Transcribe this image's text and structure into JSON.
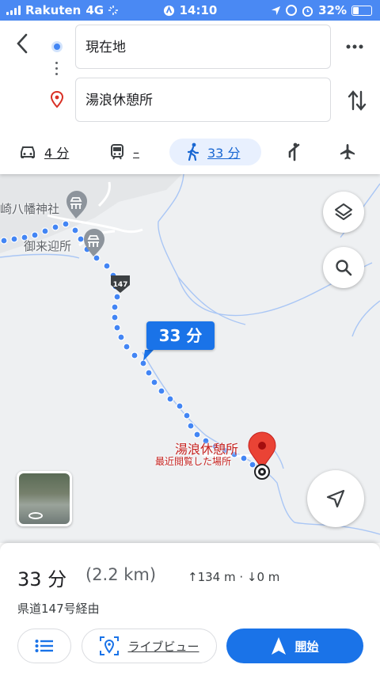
{
  "status_bar": {
    "carrier": "Rakuten",
    "network": "4G",
    "time": "14:10",
    "battery": "32%"
  },
  "directions": {
    "origin": "現在地",
    "destination": "湯浪休憩所",
    "modes": [
      {
        "icon": "car-icon",
        "label": "4 分"
      },
      {
        "icon": "train-icon",
        "label": "–"
      },
      {
        "icon": "walk-icon",
        "label": "33 分",
        "selected": true
      },
      {
        "icon": "ride-hail-icon",
        "label": ""
      },
      {
        "icon": "flight-icon",
        "label": ""
      }
    ]
  },
  "map": {
    "place_labels": [
      "崎八幡神社",
      "御来迎所"
    ],
    "road_shield": "147",
    "duration_bubble": "33 分",
    "destination_label": "湯浪休憩所",
    "destination_sublabel": "最近閲覧した場所"
  },
  "summary": {
    "duration": "33 分",
    "distance": "(2.2 km)",
    "elevation": "↑134 m · ↓0 m",
    "via": "県道147号経由",
    "live_view_label": "ライブビュー",
    "start_label": "開始"
  },
  "colors": {
    "accent": "#1a73e8",
    "status_bar": "#4a89f3",
    "route": "#4285f4",
    "destination": "#ea4335"
  }
}
